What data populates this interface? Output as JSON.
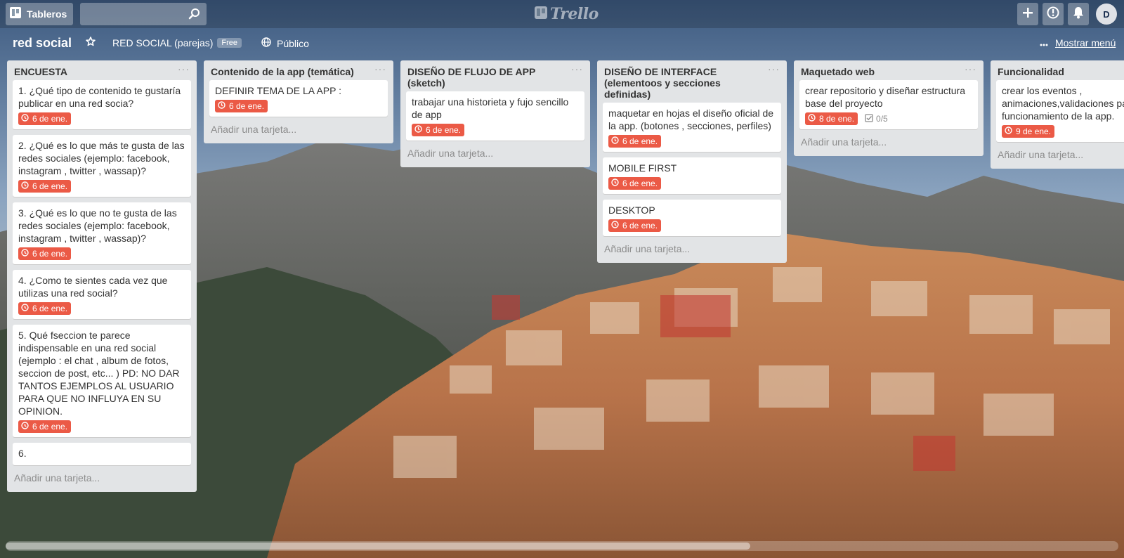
{
  "header": {
    "boards_label": "Tableros",
    "search_value": "",
    "search_placeholder": "",
    "logo_text": "Trello",
    "avatar_initial": "D"
  },
  "board": {
    "title": "red social",
    "team": "RED SOCIAL (parejas)",
    "team_badge": "Free",
    "visibility": "Público",
    "menu_label": "Mostrar menú"
  },
  "colors": {
    "due_badge": "#eb5a46",
    "list_bg": "#e2e4e6"
  },
  "lists": [
    {
      "title": "ENCUESTA",
      "cards": [
        {
          "text": "1. ¿Qué tipo de contenido te gustaría publicar en una red socia?",
          "due": "6 de ene."
        },
        {
          "text": "2. ¿Qué es lo que más te gusta de las redes sociales (ejemplo: facebook, instagram , twitter , wassap)?",
          "due": "6 de ene."
        },
        {
          "text": "3. ¿Qué es lo que no te gusta de las redes sociales (ejemplo: facebook, instagram , twitter , wassap)?",
          "due": "6 de ene."
        },
        {
          "text": "4. ¿Como te sientes cada vez que utilizas una red social?",
          "due": "6 de ene."
        },
        {
          "text": "5. Qué fseccion te parece indispensable en una red social (ejemplo : el chat , album de fotos, seccion de post, etc... ) PD: NO DAR TANTOS EJEMPLOS AL USUARIO PARA QUE NO INFLUYA EN SU OPINION.",
          "due": "6 de ene."
        },
        {
          "text": "6.",
          "due": ""
        }
      ],
      "add_label": "Añadir una tarjeta..."
    },
    {
      "title": "Contenido de la app (temática)",
      "cards": [
        {
          "text": "DEFINIR TEMA DE LA APP :",
          "due": "6 de ene."
        }
      ],
      "add_label": "Añadir una tarjeta..."
    },
    {
      "title": "DISEÑO DE FLUJO DE APP (sketch)",
      "cards": [
        {
          "text": "trabajar una historieta y fujo sencillo de app",
          "due": "6 de ene."
        }
      ],
      "add_label": "Añadir una tarjeta..."
    },
    {
      "title": "DISEÑO DE INTERFACE (elementoos y secciones definidas)",
      "cards": [
        {
          "text": "maquetar en hojas el diseño oficial de la app. (botones , secciones, perfiles)",
          "due": "6 de ene."
        },
        {
          "text": "MOBILE FIRST",
          "due": "6 de ene."
        },
        {
          "text": "DESKTOP",
          "due": "6 de ene."
        }
      ],
      "add_label": "Añadir una tarjeta..."
    },
    {
      "title": "Maquetado web",
      "cards": [
        {
          "text": "crear repositorio y diseñar estructura base del proyecto",
          "due": "8 de ene.",
          "checklist": "0/5"
        }
      ],
      "add_label": "Añadir una tarjeta..."
    },
    {
      "title": "Funcionalidad",
      "cards": [
        {
          "text": "crear los eventos , animaciones,validaciones para el funcionamiento de la app.",
          "due": "9 de ene."
        }
      ],
      "add_label": "Añadir una tarjeta..."
    }
  ]
}
